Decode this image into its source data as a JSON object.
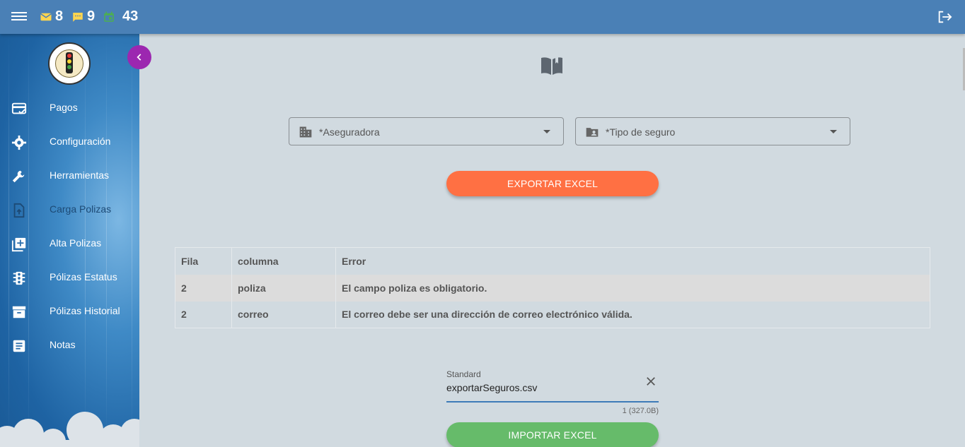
{
  "topbar": {
    "mail_count": "8",
    "message_count": "9",
    "calendar_count": "43",
    "colors": {
      "bar": "#4a80b6",
      "mail": "#ffd54f",
      "message": "#ffd54f",
      "calendar": "#4caf50"
    }
  },
  "sidebar": {
    "items": [
      {
        "label": "Pagos",
        "icon": "credit-card-check-icon"
      },
      {
        "label": "Configuración",
        "icon": "gear-icon"
      },
      {
        "label": "Herramientas",
        "icon": "wrench-icon"
      },
      {
        "label": "Carga Polizas",
        "icon": "file-upload-icon"
      },
      {
        "label": "Alta Polizas",
        "icon": "library-add-icon"
      },
      {
        "label": "Pólizas Estatus",
        "icon": "traffic-light-icon"
      },
      {
        "label": "Pólizas Historial",
        "icon": "archive-icon"
      },
      {
        "label": "Notas",
        "icon": "notes-icon"
      }
    ],
    "active_index": 3
  },
  "filters": {
    "aseguradora": "*Aseguradora",
    "tipo_seguro": "*Tipo de seguro"
  },
  "buttons": {
    "export": "EXPORTAR EXCEL",
    "import": "IMPORTAR EXCEL"
  },
  "errors_table": {
    "headers": [
      "Fila",
      "columna",
      "Error"
    ],
    "rows": [
      [
        "2",
        "poliza",
        "El campo poliza es obligatorio."
      ],
      [
        "2",
        "correo",
        "El correo debe ser una dirección de correo electrónico válida."
      ]
    ]
  },
  "file_input": {
    "label": "Standard",
    "value": "exportarSeguros.csv",
    "hint": "1 (327.0B)"
  }
}
